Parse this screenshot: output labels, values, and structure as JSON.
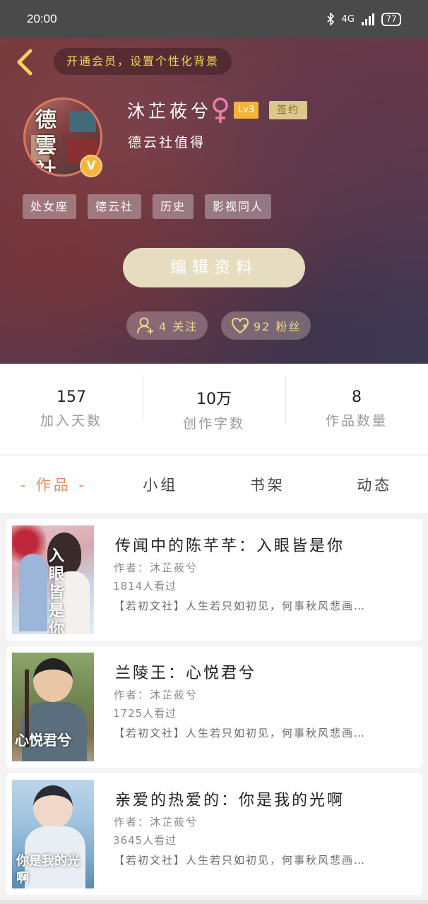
{
  "status_bar": {
    "time": "20:00",
    "network": "4G",
    "battery": "77"
  },
  "header": {
    "vip_text": "开通会员，设置个性化背景",
    "avatar_chars": [
      "德",
      "雲",
      "社"
    ],
    "verified_mark": "V",
    "user_name": "沐芷莜兮",
    "level": "Lv3",
    "sign_badge": "签约",
    "bio": "德云社值得",
    "tags": [
      "处女座",
      "德云社",
      "历史",
      "影视同人"
    ],
    "edit_button": "编辑资料",
    "follow": "4 关注",
    "fans": "92 粉丝"
  },
  "stats": [
    {
      "value": "157",
      "label": "加入天数"
    },
    {
      "value": "10万",
      "label": "创作字数"
    },
    {
      "value": "8",
      "label": "作品数量"
    }
  ],
  "tabs": [
    "- 作品 -",
    "小组",
    "书架",
    "动态"
  ],
  "works": [
    {
      "title": "传闻中的陈芊芊：入眼皆是你",
      "author": "作者：沐芷莜兮",
      "views": "1814人看过",
      "summary": "【若初文社】人生若只如初见，何事秋风悲画…",
      "cover_text": "入眼皆是你"
    },
    {
      "title": "兰陵王：心悦君兮",
      "author": "作者：沐芷莜兮",
      "views": "1725人看过",
      "summary": "【若初文社】人生若只如初见，何事秋风悲画…",
      "cover_text": "心悦君兮"
    },
    {
      "title": "亲爱的热爱的：你是我的光啊",
      "author": "作者：沐芷莜兮",
      "views": "3645人看过",
      "summary": "【若初文社】人生若只如初见，何事秋风悲画…",
      "cover_text": "你是我的光啊"
    }
  ],
  "colors": {
    "accent_gold": "#f4d35e",
    "tab_active": "#ef8a55",
    "level_badge": "#f4b33b",
    "gender_pink": "#f07aa6"
  }
}
